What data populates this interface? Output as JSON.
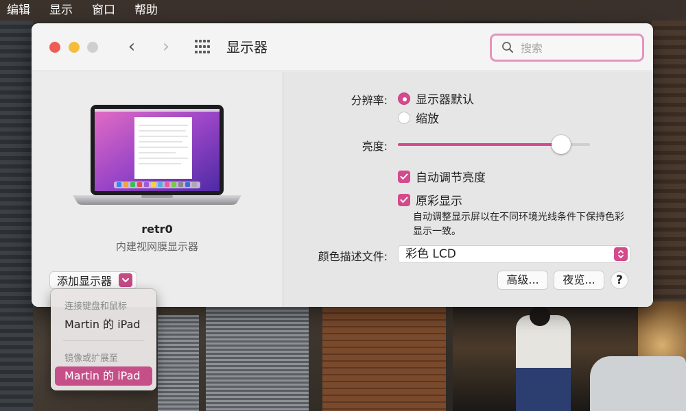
{
  "menubar": {
    "items": [
      "编辑",
      "显示",
      "窗口",
      "帮助"
    ]
  },
  "window": {
    "title": "显示器",
    "search": {
      "placeholder": "搜索",
      "value": ""
    }
  },
  "device": {
    "name": "retr0",
    "type": "内建视网膜显示器",
    "add_display_label": "添加显示器"
  },
  "settings": {
    "resolution_label": "分辨率:",
    "resolution_options": [
      {
        "label": "显示器默认",
        "selected": true
      },
      {
        "label": "缩放",
        "selected": false
      }
    ],
    "brightness_label": "亮度:",
    "brightness_level": 0.85,
    "auto_brightness_label": "自动调节亮度",
    "auto_brightness_checked": true,
    "true_tone_label": "原彩显示",
    "true_tone_checked": true,
    "true_tone_desc": "自动调整显示屏以在不同环境光线条件下保持色彩显示一致。",
    "color_profile_label": "颜色描述文件:",
    "color_profile_value": "彩色 LCD",
    "advanced_button": "高级...",
    "night_shift_button": "夜览...",
    "help_button": "?"
  },
  "dropdown": {
    "section1_header": "连接键盘和鼠标",
    "section1_item": "Martin 的 iPad",
    "section2_header": "镜像或扩展至",
    "section2_item": "Martin 的 iPad"
  },
  "colors": {
    "accent": "#d34b8c",
    "search_border": "#e593bf"
  }
}
